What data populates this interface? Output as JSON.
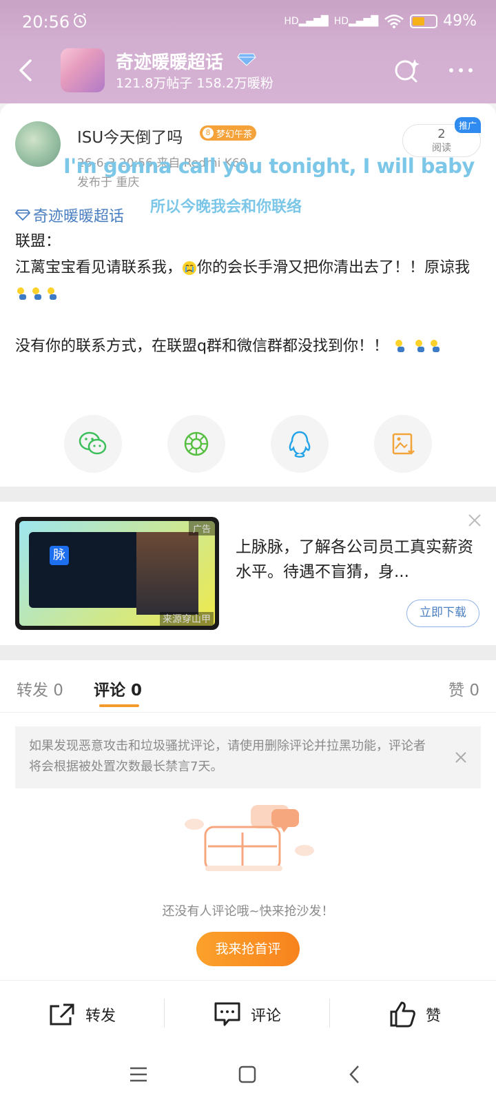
{
  "status_bar": {
    "time": "20:56",
    "signal1": "HD",
    "signal2": "HD",
    "battery": "49%"
  },
  "header": {
    "topic_title": "奇迹暖暖超话",
    "topic_stats": "121.8万帖子 158.2万暖粉"
  },
  "post": {
    "author_name": "ISU今天倒了吗",
    "author_level": "8",
    "author_badge": "梦幻午茶",
    "meta": "26-6-3 20:56  来自 Redmi K60",
    "location": "发布于 重庆",
    "read_count": "2",
    "read_label": "阅读",
    "promo_tag": "推广",
    "lyric_line1": "I'm gonna call you tonight, I will baby",
    "lyric_line2": "所以今晚我会和你联络",
    "topic_link": "奇迹暖暖超话",
    "body_line1": "联盟：",
    "body_line2a": "江蓠宝宝看见请联系我，",
    "body_line2b": "你的会长手滑又把你清出去了！！原谅我",
    "body_line3": "没有你的联系方式，在联盟q群和微信群都没找到你！！"
  },
  "share": [
    "wechat-icon",
    "moments-icon",
    "qq-icon",
    "save-image-icon"
  ],
  "ad": {
    "label": "广告",
    "source": "来源穿山甲",
    "logo_text": "脉",
    "text": "上脉脉，了解各公司员工真实薪资水平。待遇不盲猜，身...",
    "download": "立即下载"
  },
  "comments": {
    "tab_repost": "转发 0",
    "tab_comment": "评论 0",
    "tab_like": "赞 0",
    "notice": "如果发现恶意攻击和垃圾骚扰评论，请使用删除评论并拉黑功能，评论者将会根据被处置次数最长禁言7天。",
    "empty_text": "还没有人评论哦~快来抢沙发！",
    "first_button": "我来抢首评"
  },
  "action_bar": {
    "repost": "转发",
    "comment": "评论",
    "like": "赞"
  },
  "colors": {
    "accent": "#f39a2c",
    "link": "#4a7fc1",
    "lyric": "#7cc7e8"
  }
}
